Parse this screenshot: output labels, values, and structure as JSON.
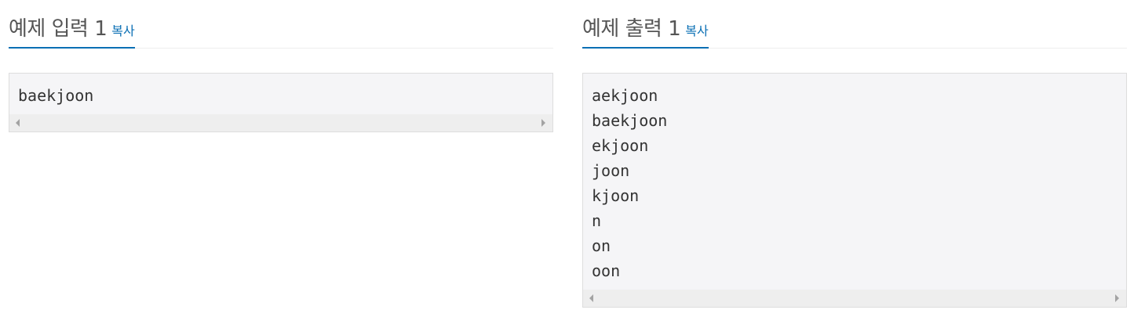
{
  "sample_input": {
    "title": "예제 입력 1",
    "copy_label": "복사",
    "lines": [
      "baekjoon"
    ]
  },
  "sample_output": {
    "title": "예제 출력 1",
    "copy_label": "복사",
    "lines": [
      "aekjoon",
      "baekjoon",
      "ekjoon",
      "joon",
      "kjoon",
      "n",
      "on",
      "oon"
    ]
  },
  "colors": {
    "accent": "#0a6fb4",
    "code_background": "#f5f5f7"
  },
  "icons": [
    "scroll-left-arrow-icon",
    "scroll-right-arrow-icon"
  ]
}
